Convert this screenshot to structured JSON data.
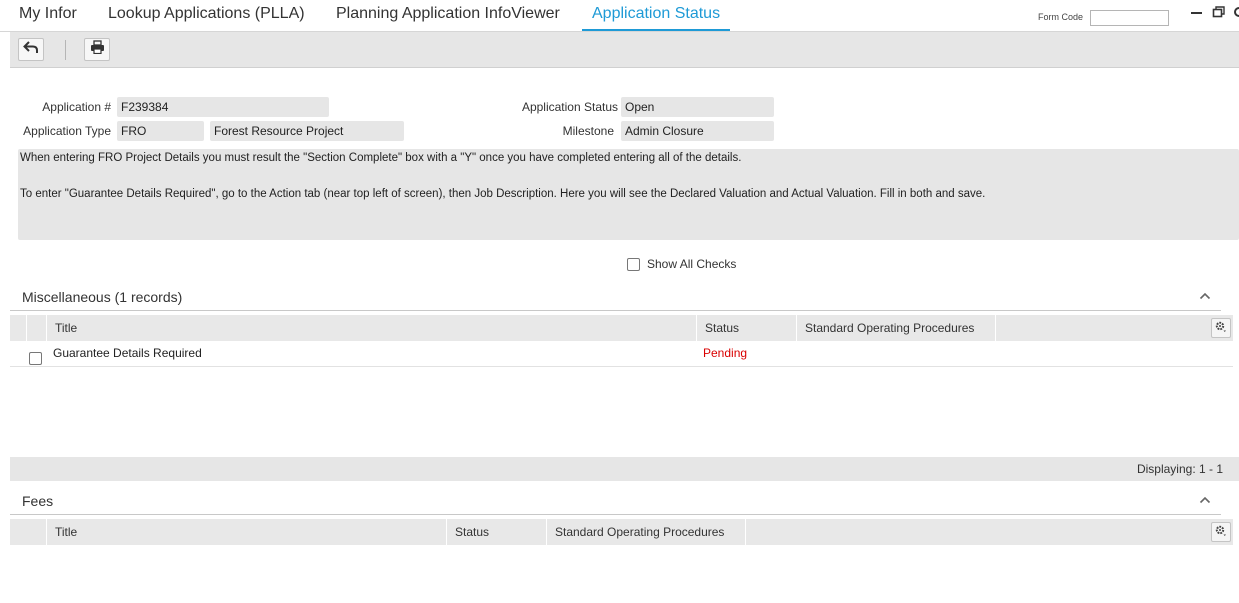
{
  "tabs": [
    {
      "label": "My Infor"
    },
    {
      "label": "Lookup Applications (PLLA)"
    },
    {
      "label": "Planning Application InfoViewer"
    },
    {
      "label": "Application Status",
      "active": true
    }
  ],
  "form_code": {
    "label": "Form Code",
    "value": ""
  },
  "toolbar": {
    "back_icon": "back-arrow-icon",
    "print_icon": "printer-icon"
  },
  "header": {
    "application_number": {
      "label": "Application #",
      "value": "F239384"
    },
    "application_type": {
      "label": "Application Type",
      "code": "FRO",
      "description": "Forest Resource Project"
    },
    "application_status": {
      "label": "Application Status",
      "value": "Open"
    },
    "milestone": {
      "label": "Milestone",
      "value": "Admin Closure"
    }
  },
  "note": {
    "line1": "When entering FRO Project Details you must result the \"Section Complete\" box with a \"Y\" once you have completed entering all of the details.",
    "line2": "To enter \"Guarantee Details Required\", go to the Action tab (near top left of screen), then Job Description.  Here you will see the Declared Valuation and Actual Valuation.  Fill in both and save."
  },
  "show_all_checks": {
    "label": "Show All Checks",
    "checked": false
  },
  "miscellaneous": {
    "title": "Miscellaneous (1 records)",
    "columns": [
      "Title",
      "Status",
      "Standard Operating Procedures"
    ],
    "rows": [
      {
        "title": "Guarantee Details Required",
        "status": "Pending",
        "sop": ""
      }
    ],
    "footer": "Displaying: 1 - 1"
  },
  "fees": {
    "title": "Fees",
    "columns": [
      "Title",
      "Status",
      "Standard Operating Procedures"
    ]
  },
  "colors": {
    "accent": "#1e9ad6",
    "pending": "#d90000",
    "panel": "#e6e6e6"
  }
}
